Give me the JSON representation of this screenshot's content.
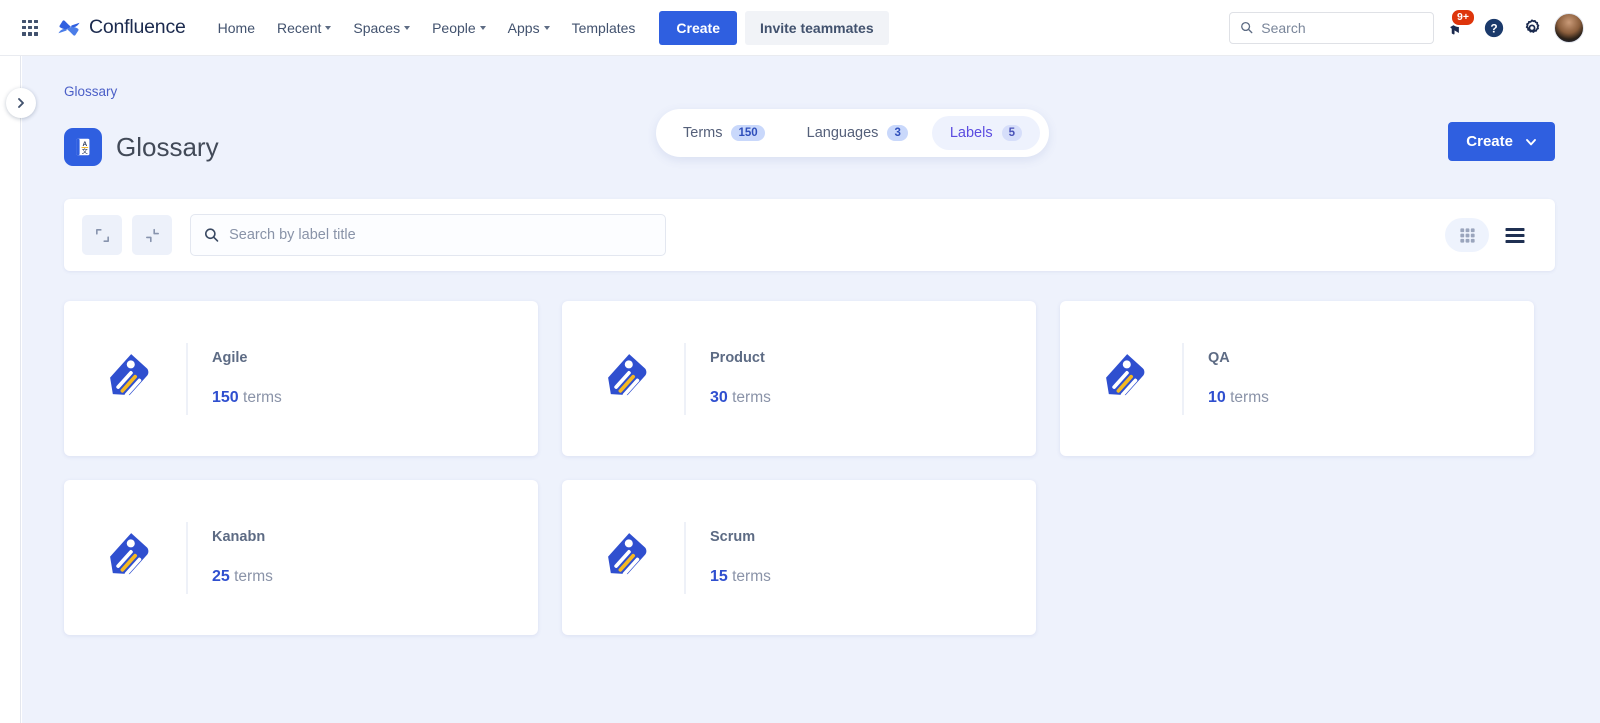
{
  "topnav": {
    "app_switcher_icon": "grid-apps-icon",
    "brand": "Confluence",
    "links": [
      {
        "label": "Home",
        "has_caret": false
      },
      {
        "label": "Recent",
        "has_caret": true
      },
      {
        "label": "Spaces",
        "has_caret": true
      },
      {
        "label": "People",
        "has_caret": true
      },
      {
        "label": "Apps",
        "has_caret": true
      },
      {
        "label": "Templates",
        "has_caret": false
      }
    ],
    "create_label": "Create",
    "invite_label": "Invite teammates",
    "search_placeholder": "Search",
    "search_value": "",
    "notification_badge": "9+",
    "icons": [
      "megaphone-icon",
      "help-icon",
      "settings-gear-icon",
      "avatar"
    ]
  },
  "sidebar": {
    "expand_icon": "chevron-right-icon"
  },
  "page": {
    "breadcrumb": "Glossary",
    "title": "Glossary",
    "title_icon": "glossary-book-icon",
    "create_label": "Create",
    "create_caret_icon": "chevron-down-icon"
  },
  "tabs": [
    {
      "label": "Terms",
      "count": "150",
      "active": false
    },
    {
      "label": "Languages",
      "count": "3",
      "active": false
    },
    {
      "label": "Labels",
      "count": "5",
      "active": true
    }
  ],
  "toolbar": {
    "expand_all_icon": "expand-icon",
    "collapse_all_icon": "collapse-icon",
    "search_icon": "search-icon",
    "search_placeholder": "Search by label title",
    "search_value": "",
    "grid_view_icon": "grid-view-icon",
    "list_view_icon": "list-view-icon",
    "active_view": "grid"
  },
  "cards": [
    {
      "title": "Agile",
      "count": "150",
      "unit": "terms",
      "icon": "tag-icon"
    },
    {
      "title": "Product",
      "count": "30",
      "unit": "terms",
      "icon": "tag-icon"
    },
    {
      "title": "QA",
      "count": "10",
      "unit": "terms",
      "icon": "tag-icon"
    },
    {
      "title": "Kanabn",
      "count": "25",
      "unit": "terms",
      "icon": "tag-icon"
    },
    {
      "title": "Scrum",
      "count": "15",
      "unit": "terms",
      "icon": "tag-icon"
    }
  ],
  "colors": {
    "brand_blue": "#2f5fe0",
    "tag_blue": "#2f4fcf",
    "tag_yellow": "#f5b921",
    "page_bg": "#eef2fc",
    "active_tab_text": "#5b4ce0",
    "badge_red": "#de350b"
  }
}
